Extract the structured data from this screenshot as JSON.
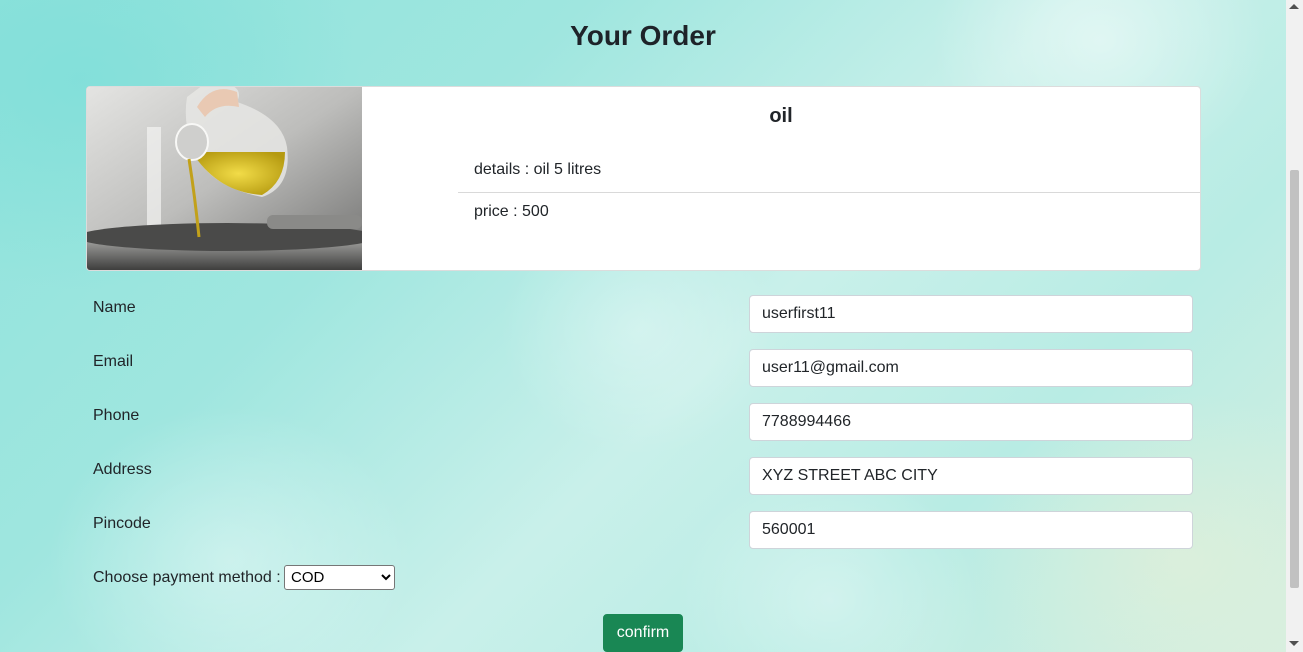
{
  "page": {
    "title": "Your Order"
  },
  "product": {
    "image_icon": "olive-oil-pouring-photo",
    "name": "oil",
    "details": "details : oil 5 litres",
    "price": "price : 500"
  },
  "form": {
    "fields": [
      {
        "label": "Name",
        "value": "userfirst11"
      },
      {
        "label": "Email",
        "value": "user11@gmail.com"
      },
      {
        "label": "Phone",
        "value": "7788994466"
      },
      {
        "label": "Address",
        "value": "XYZ STREET ABC CITY"
      },
      {
        "label": "Pincode",
        "value": "560001"
      }
    ],
    "payment_label": "Choose payment method :",
    "payment_selected": "COD",
    "confirm_label": "confirm"
  },
  "colors": {
    "confirm_button": "#198754",
    "accent_background": "#9fe6df"
  }
}
